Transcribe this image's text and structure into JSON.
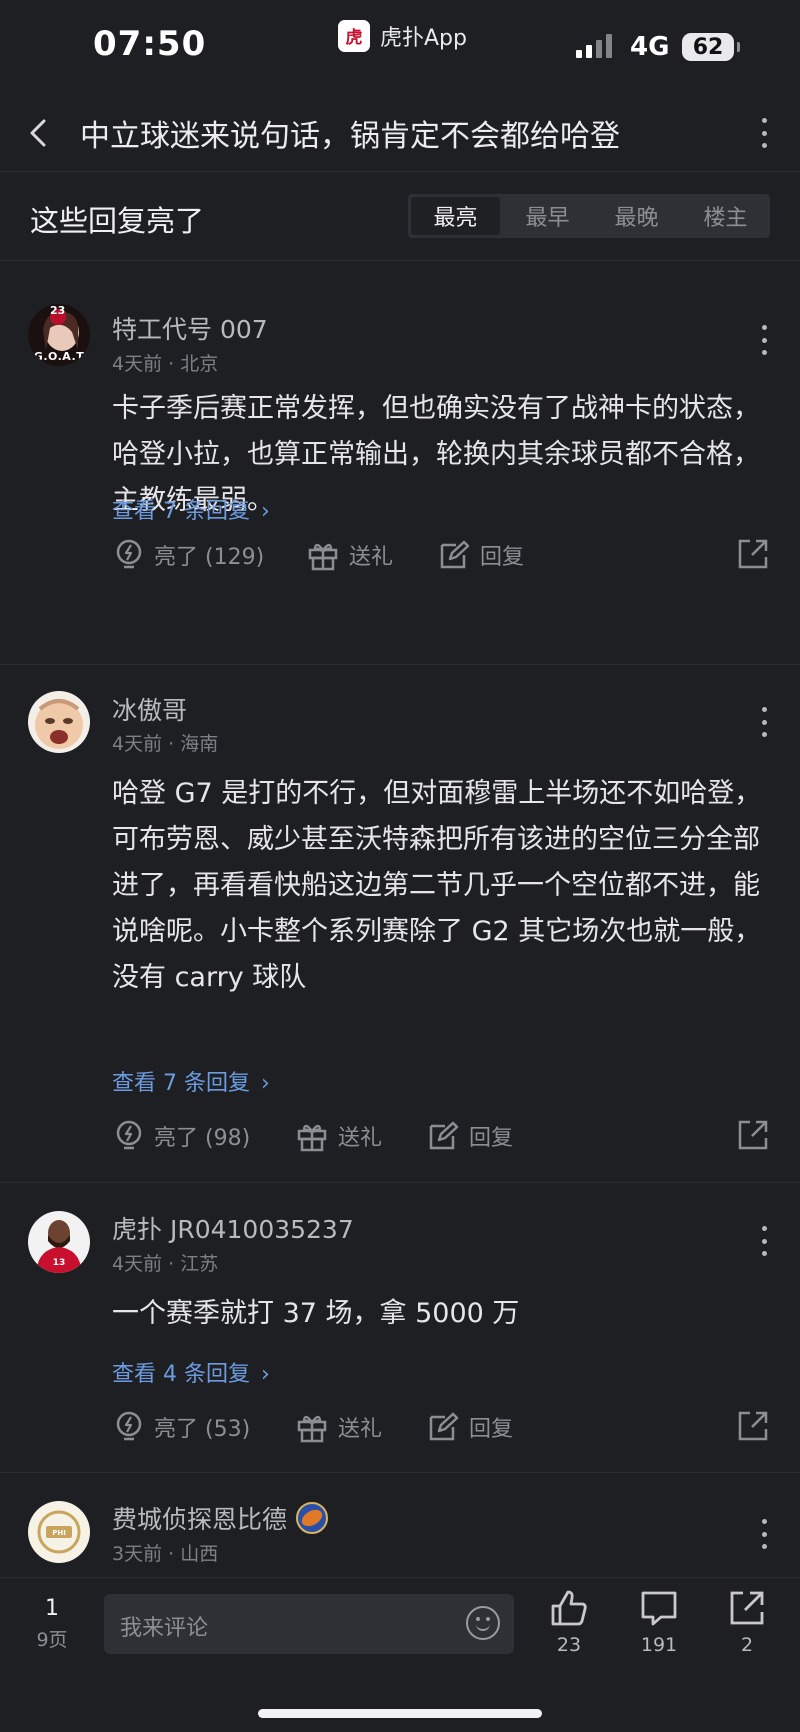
{
  "status_bar": {
    "time": "07:50",
    "app_name": "虎扑App",
    "app_logo_char": "虎扑",
    "network": "4G",
    "battery": "62"
  },
  "header": {
    "title": "中立球迷来说句话，锅肯定不会都给哈登"
  },
  "sort": {
    "section_title": "这些回复亮了",
    "tabs": [
      "最亮",
      "最早",
      "最晚",
      "楼主"
    ],
    "active_tab": "最亮"
  },
  "comments": [
    {
      "username": "特工代号 007",
      "meta": "4天前 · 北京",
      "avatar_badge": "G.O.A.T",
      "avatar_number": "23",
      "body": "卡子季后赛正常发挥，但也确实没有了战神卡的状态，哈登小拉，也算正常输出，轮换内其余球员都不合格，主教练最弱。",
      "replies": "查看 7 条回复",
      "likes": "亮了 (129)",
      "gift": "送礼",
      "reply": "回复"
    },
    {
      "username": "冰傲哥",
      "meta": "4天前 · 海南",
      "body": "哈登 G7 是打的不行，但对面穆雷上半场还不如哈登，可布劳恩、威少甚至沃特森把所有该进的空位三分全部进了，再看看快船这边第二节几乎一个空位都不进，能说啥呢。小卡整个系列赛除了 G2 其它场次也就一般，没有 carry 球队",
      "replies": "查看 7 条回复",
      "likes": "亮了 (98)",
      "gift": "送礼",
      "reply": "回复"
    },
    {
      "username": "虎扑 JR0410035237",
      "meta": "4天前 · 江苏",
      "body": "一个赛季就打 37 场，拿 5000 万",
      "replies": "查看 4 条回复",
      "likes": "亮了 (53)",
      "gift": "送礼",
      "reply": "回复"
    },
    {
      "username": "费城侦探恩比德",
      "meta": "3天前 · 山西"
    }
  ],
  "bottom_bar": {
    "page_current": "1",
    "page_total": "9页",
    "input_placeholder": "我来评论",
    "like_count": "23",
    "comment_count": "191",
    "share_count": "2"
  },
  "colors": {
    "background": "#1e1f23",
    "link_blue": "#6d9be0",
    "text_primary": "#e6e6e8",
    "text_secondary": "#7e7f85"
  }
}
